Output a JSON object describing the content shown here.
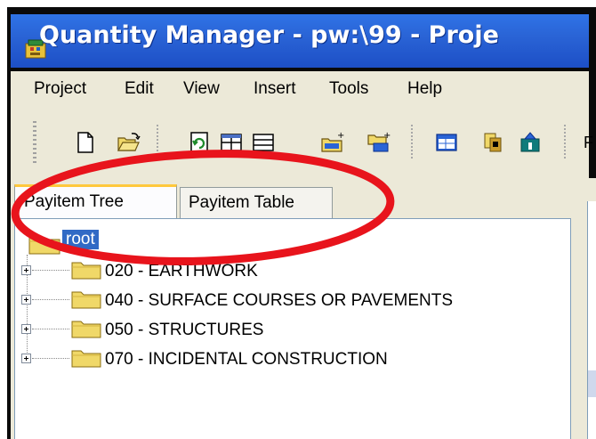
{
  "window": {
    "title": "Quantity Manager - pw:\\99 - Proje",
    "title_color": "#ffffff",
    "title_bar_color": "#2a64d6"
  },
  "menu": {
    "items": [
      "Project",
      "Edit",
      "View",
      "Insert",
      "Tools",
      "Help"
    ]
  },
  "toolbar": {
    "buttons": [
      {
        "icon": "new-document-icon"
      },
      {
        "icon": "open-folder-icon"
      },
      {
        "icon": "refresh-document-icon"
      },
      {
        "icon": "insert-columns-icon"
      },
      {
        "icon": "insert-rows-icon"
      },
      {
        "icon": "add-folder-icon"
      },
      {
        "icon": "add-item-icon"
      },
      {
        "icon": "table-window-icon"
      },
      {
        "icon": "copy-items-icon"
      },
      {
        "icon": "export-icon"
      }
    ],
    "cut_label": "F"
  },
  "tabs": [
    {
      "label": "Payitem Tree",
      "active": true
    },
    {
      "label": "Payitem Table",
      "active": false
    }
  ],
  "tree": {
    "root": "root",
    "items": [
      {
        "label": "020 - EARTHWORK"
      },
      {
        "label": "040 - SURFACE COURSES OR PAVEMENTS"
      },
      {
        "label": "050 - STRUCTURES"
      },
      {
        "label": "070 - INCIDENTAL CONSTRUCTION"
      }
    ]
  },
  "annotation": {
    "shape": "ellipse",
    "color": "#e8141c"
  },
  "colors": {
    "selection": "#316ac5",
    "folder": "#f0d868",
    "tab_highlight": "#ffc83c"
  }
}
